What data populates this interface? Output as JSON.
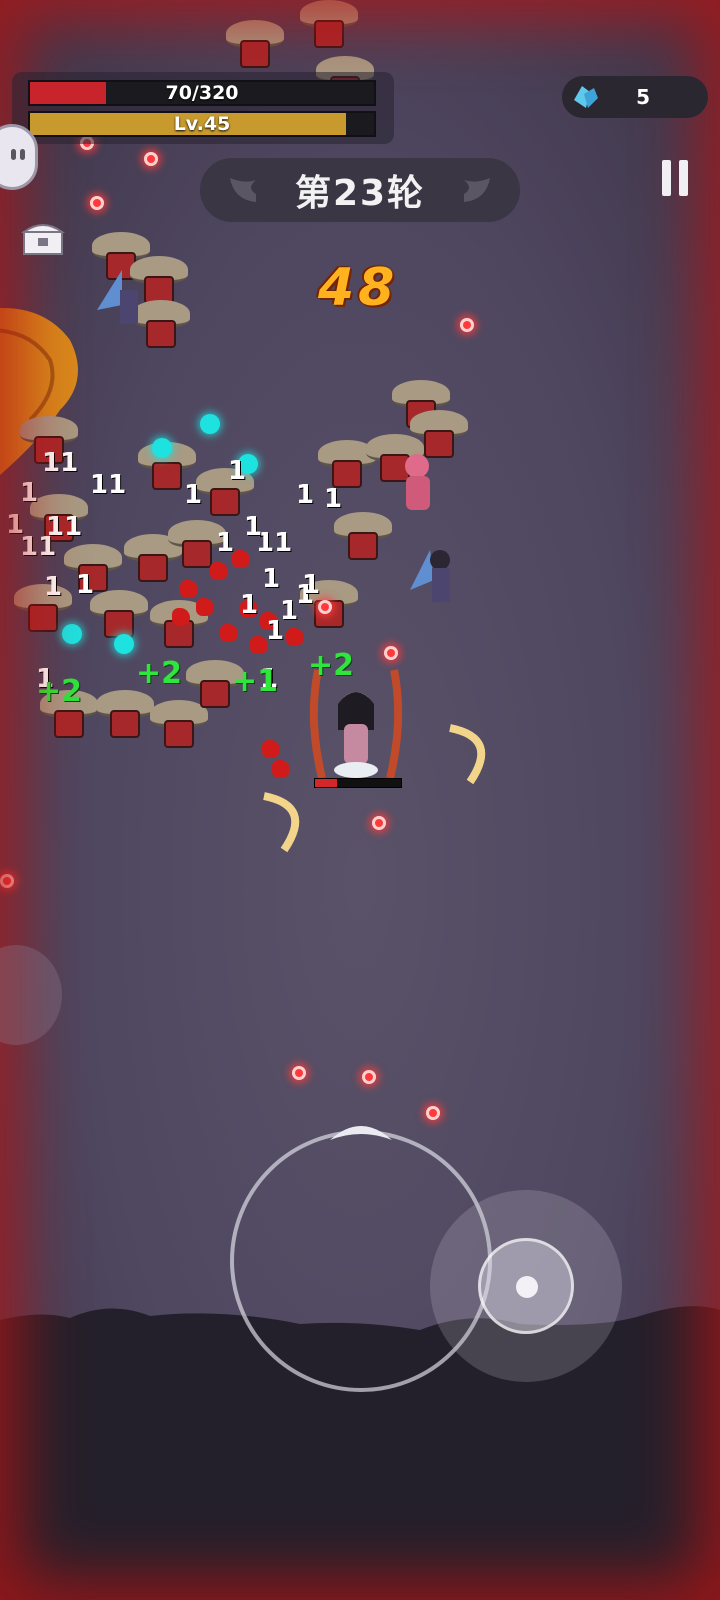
{
  "hud": {
    "hp_text": "70/320",
    "hp_fraction": 0.22,
    "level_text": "Lv.45",
    "level_fraction": 0.92,
    "gem_count": "5",
    "gem_icon": "blue-crystal-icon"
  },
  "round": {
    "label": "第23轮"
  },
  "combo": {
    "value": "48",
    "color": "#ffb21e"
  },
  "hero": {
    "hp_fraction": 0.25
  },
  "floating_numbers": {
    "damage": [
      "11",
      "1",
      "11",
      "1",
      "11",
      "11",
      "11",
      "1",
      "1",
      "1",
      "1",
      "1",
      "1",
      "1",
      "1",
      "1",
      "1",
      "1",
      "1",
      "1",
      "1",
      "1",
      "1"
    ],
    "heal": [
      "+2",
      "+2",
      "+1",
      "+2"
    ]
  },
  "colors": {
    "danger_vignette": "#b41414",
    "hp": "#c8242c",
    "exp": "#c89a2e",
    "heal": "#2ee63c",
    "bullet": "#ff3a3a",
    "orb": "#1ee2e0"
  },
  "icons": [
    "pause-icon",
    "chest-icon",
    "chat-bubble-icon",
    "blue-crystal-icon",
    "wing-icon",
    "joystick-icon",
    "skill-icon"
  ]
}
